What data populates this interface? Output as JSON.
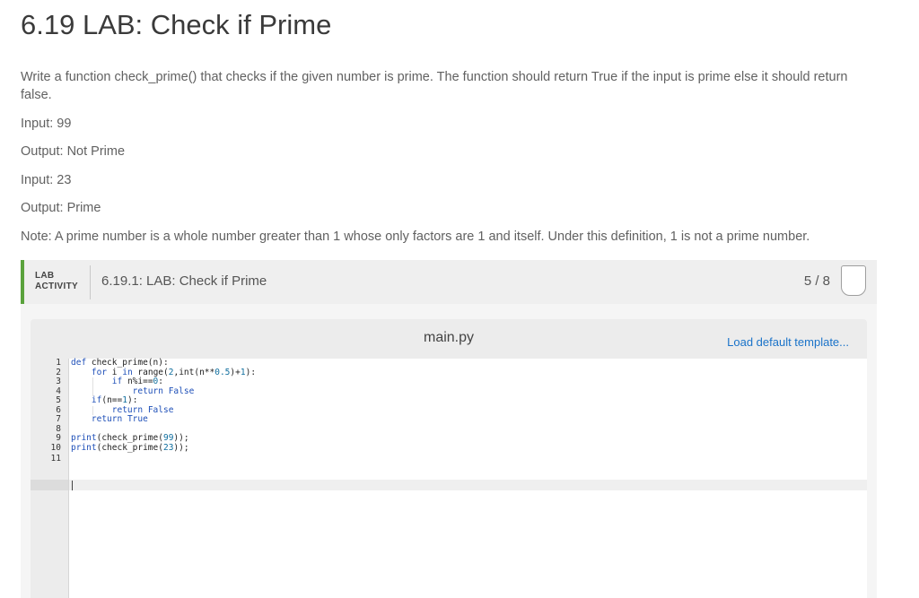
{
  "page": {
    "title": "6.19 LAB: Check if Prime",
    "description": "Write a function check_prime() that checks if the given number is prime. The function should return True if the input is prime else it should return false.",
    "examples": [
      "Input: 99",
      "Output: Not Prime",
      "Input: 23",
      "Output: Prime"
    ],
    "note": "Note: A prime number is a whole number greater than 1 whose only factors are 1 and itself. Under this definition, 1 is not a prime number."
  },
  "lab": {
    "tag_line1": "LAB",
    "tag_line2": "ACTIVITY",
    "title": "6.19.1: LAB: Check if Prime",
    "score": "5 / 8",
    "accent_color": "#5aa23c"
  },
  "editor": {
    "file_name": "main.py",
    "load_template": "Load default template...",
    "lines": [
      {
        "n": "1",
        "tokens": [
          [
            "kw",
            "def"
          ],
          [
            "t",
            " check_prime(n):"
          ]
        ]
      },
      {
        "n": "2",
        "tokens": [
          [
            "t",
            "    "
          ],
          [
            "kw",
            "for"
          ],
          [
            "t",
            " i "
          ],
          [
            "kw",
            "in"
          ],
          [
            "t",
            " range("
          ],
          [
            "num",
            "2"
          ],
          [
            "t",
            ",int(n**"
          ],
          [
            "num",
            "0.5"
          ],
          [
            "t",
            ")+"
          ],
          [
            "num",
            "1"
          ],
          [
            "t",
            "):"
          ]
        ]
      },
      {
        "n": "3",
        "tokens": [
          [
            "t",
            "        "
          ],
          [
            "kw",
            "if"
          ],
          [
            "t",
            " n%i=="
          ],
          [
            "num",
            "0"
          ],
          [
            "t",
            ":"
          ]
        ]
      },
      {
        "n": "4",
        "tokens": [
          [
            "t",
            "            "
          ],
          [
            "kw",
            "return"
          ],
          [
            "t",
            " "
          ],
          [
            "kw",
            "False"
          ]
        ]
      },
      {
        "n": "5",
        "tokens": [
          [
            "t",
            "    "
          ],
          [
            "kw",
            "if"
          ],
          [
            "t",
            "(n=="
          ],
          [
            "num",
            "1"
          ],
          [
            "t",
            "):"
          ]
        ]
      },
      {
        "n": "6",
        "tokens": [
          [
            "t",
            "        "
          ],
          [
            "kw",
            "return"
          ],
          [
            "t",
            " "
          ],
          [
            "kw",
            "False"
          ]
        ]
      },
      {
        "n": "7",
        "tokens": [
          [
            "t",
            "    "
          ],
          [
            "kw",
            "return"
          ],
          [
            "t",
            " "
          ],
          [
            "kw",
            "True"
          ]
        ]
      },
      {
        "n": "8",
        "tokens": []
      },
      {
        "n": "9",
        "tokens": [
          [
            "kw",
            "print"
          ],
          [
            "t",
            "(check_prime("
          ],
          [
            "num",
            "99"
          ],
          [
            "t",
            "));"
          ]
        ]
      },
      {
        "n": "10",
        "tokens": [
          [
            "kw",
            "print"
          ],
          [
            "t",
            "(check_prime("
          ],
          [
            "num",
            "23"
          ],
          [
            "t",
            "));"
          ]
        ]
      },
      {
        "n": "11",
        "tokens": []
      }
    ]
  }
}
